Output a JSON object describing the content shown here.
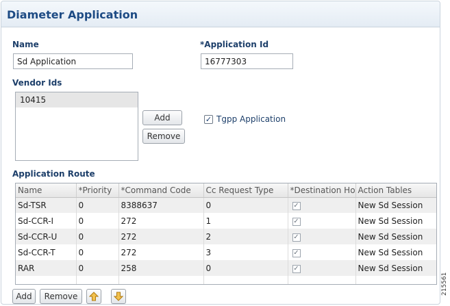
{
  "header": {
    "title": "Diameter Application"
  },
  "form": {
    "name_label": "Name",
    "name_value": "Sd Application",
    "app_id_label": "*Application Id",
    "app_id_value": "16777303",
    "vendor_ids_label": "Vendor Ids",
    "vendor_ids": [
      "10415"
    ],
    "vendor_add_label": "Add",
    "vendor_remove_label": "Remove",
    "tgpp_label": "Tgpp Application",
    "tgpp_checked": true
  },
  "route": {
    "label": "Application Route",
    "columns": [
      "Name",
      "*Priority",
      "*Command Code",
      "Cc Request Type",
      "*Destination Host",
      "Action Tables"
    ],
    "rows": [
      {
        "name": "Sd-TSR",
        "priority": "0",
        "code": "8388637",
        "cc_type": "0",
        "dest_checked": true,
        "action": "New Sd Session"
      },
      {
        "name": "Sd-CCR-I",
        "priority": "0",
        "code": "272",
        "cc_type": "1",
        "dest_checked": true,
        "action": "New Sd Session"
      },
      {
        "name": "Sd-CCR-U",
        "priority": "0",
        "code": "272",
        "cc_type": "2",
        "dest_checked": true,
        "action": "New Sd Session"
      },
      {
        "name": "Sd-CCR-T",
        "priority": "0",
        "code": "272",
        "cc_type": "3",
        "dest_checked": true,
        "action": "New Sd Session"
      },
      {
        "name": "RAR",
        "priority": "0",
        "code": "258",
        "cc_type": "0",
        "dest_checked": true,
        "action": "New Sd Session"
      }
    ],
    "add_label": "Add",
    "remove_label": "Remove",
    "up_icon": "arrow-up-icon",
    "down_icon": "arrow-down-icon"
  },
  "figure_id": "215561",
  "colors": {
    "title": "#1d4b84",
    "label": "#1d3f6a",
    "arrow": "#e8a317"
  }
}
